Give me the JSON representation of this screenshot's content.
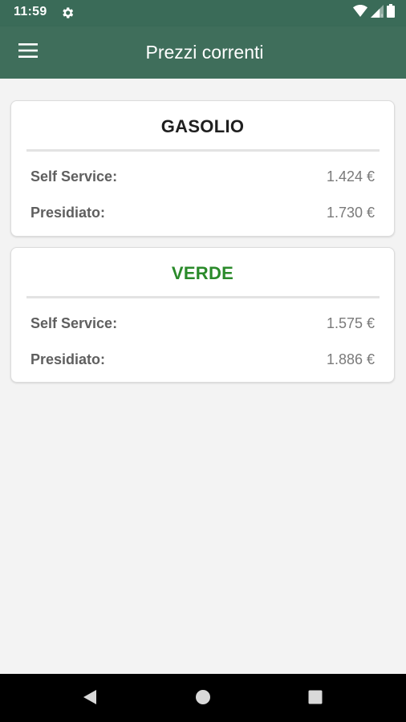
{
  "status_bar": {
    "time": "11:59",
    "icons": [
      "gear-icon",
      "wifi-icon",
      "signal-icon",
      "battery-icon"
    ]
  },
  "app_bar": {
    "title": "Prezzi correnti",
    "menu_icon": "hamburger-menu-icon"
  },
  "colors": {
    "primary": "#3f6e5b",
    "status_bar": "#3a6b58",
    "gasolio_title": "#1f1f1f",
    "verde_title": "#2a8a2a",
    "background": "#f3f3f3"
  },
  "fuels": [
    {
      "name": "GASOLIO",
      "self_service_label": "Self Service:",
      "self_service_price": "1.424 €",
      "presidiato_label": "Presidiato:",
      "presidiato_price": "1.730 €"
    },
    {
      "name": "VERDE",
      "self_service_label": "Self Service:",
      "self_service_price": "1.575 €",
      "presidiato_label": "Presidiato:",
      "presidiato_price": "1.886 €"
    }
  ],
  "nav_bar": {
    "buttons": [
      "back-icon",
      "home-icon",
      "recents-icon"
    ]
  }
}
